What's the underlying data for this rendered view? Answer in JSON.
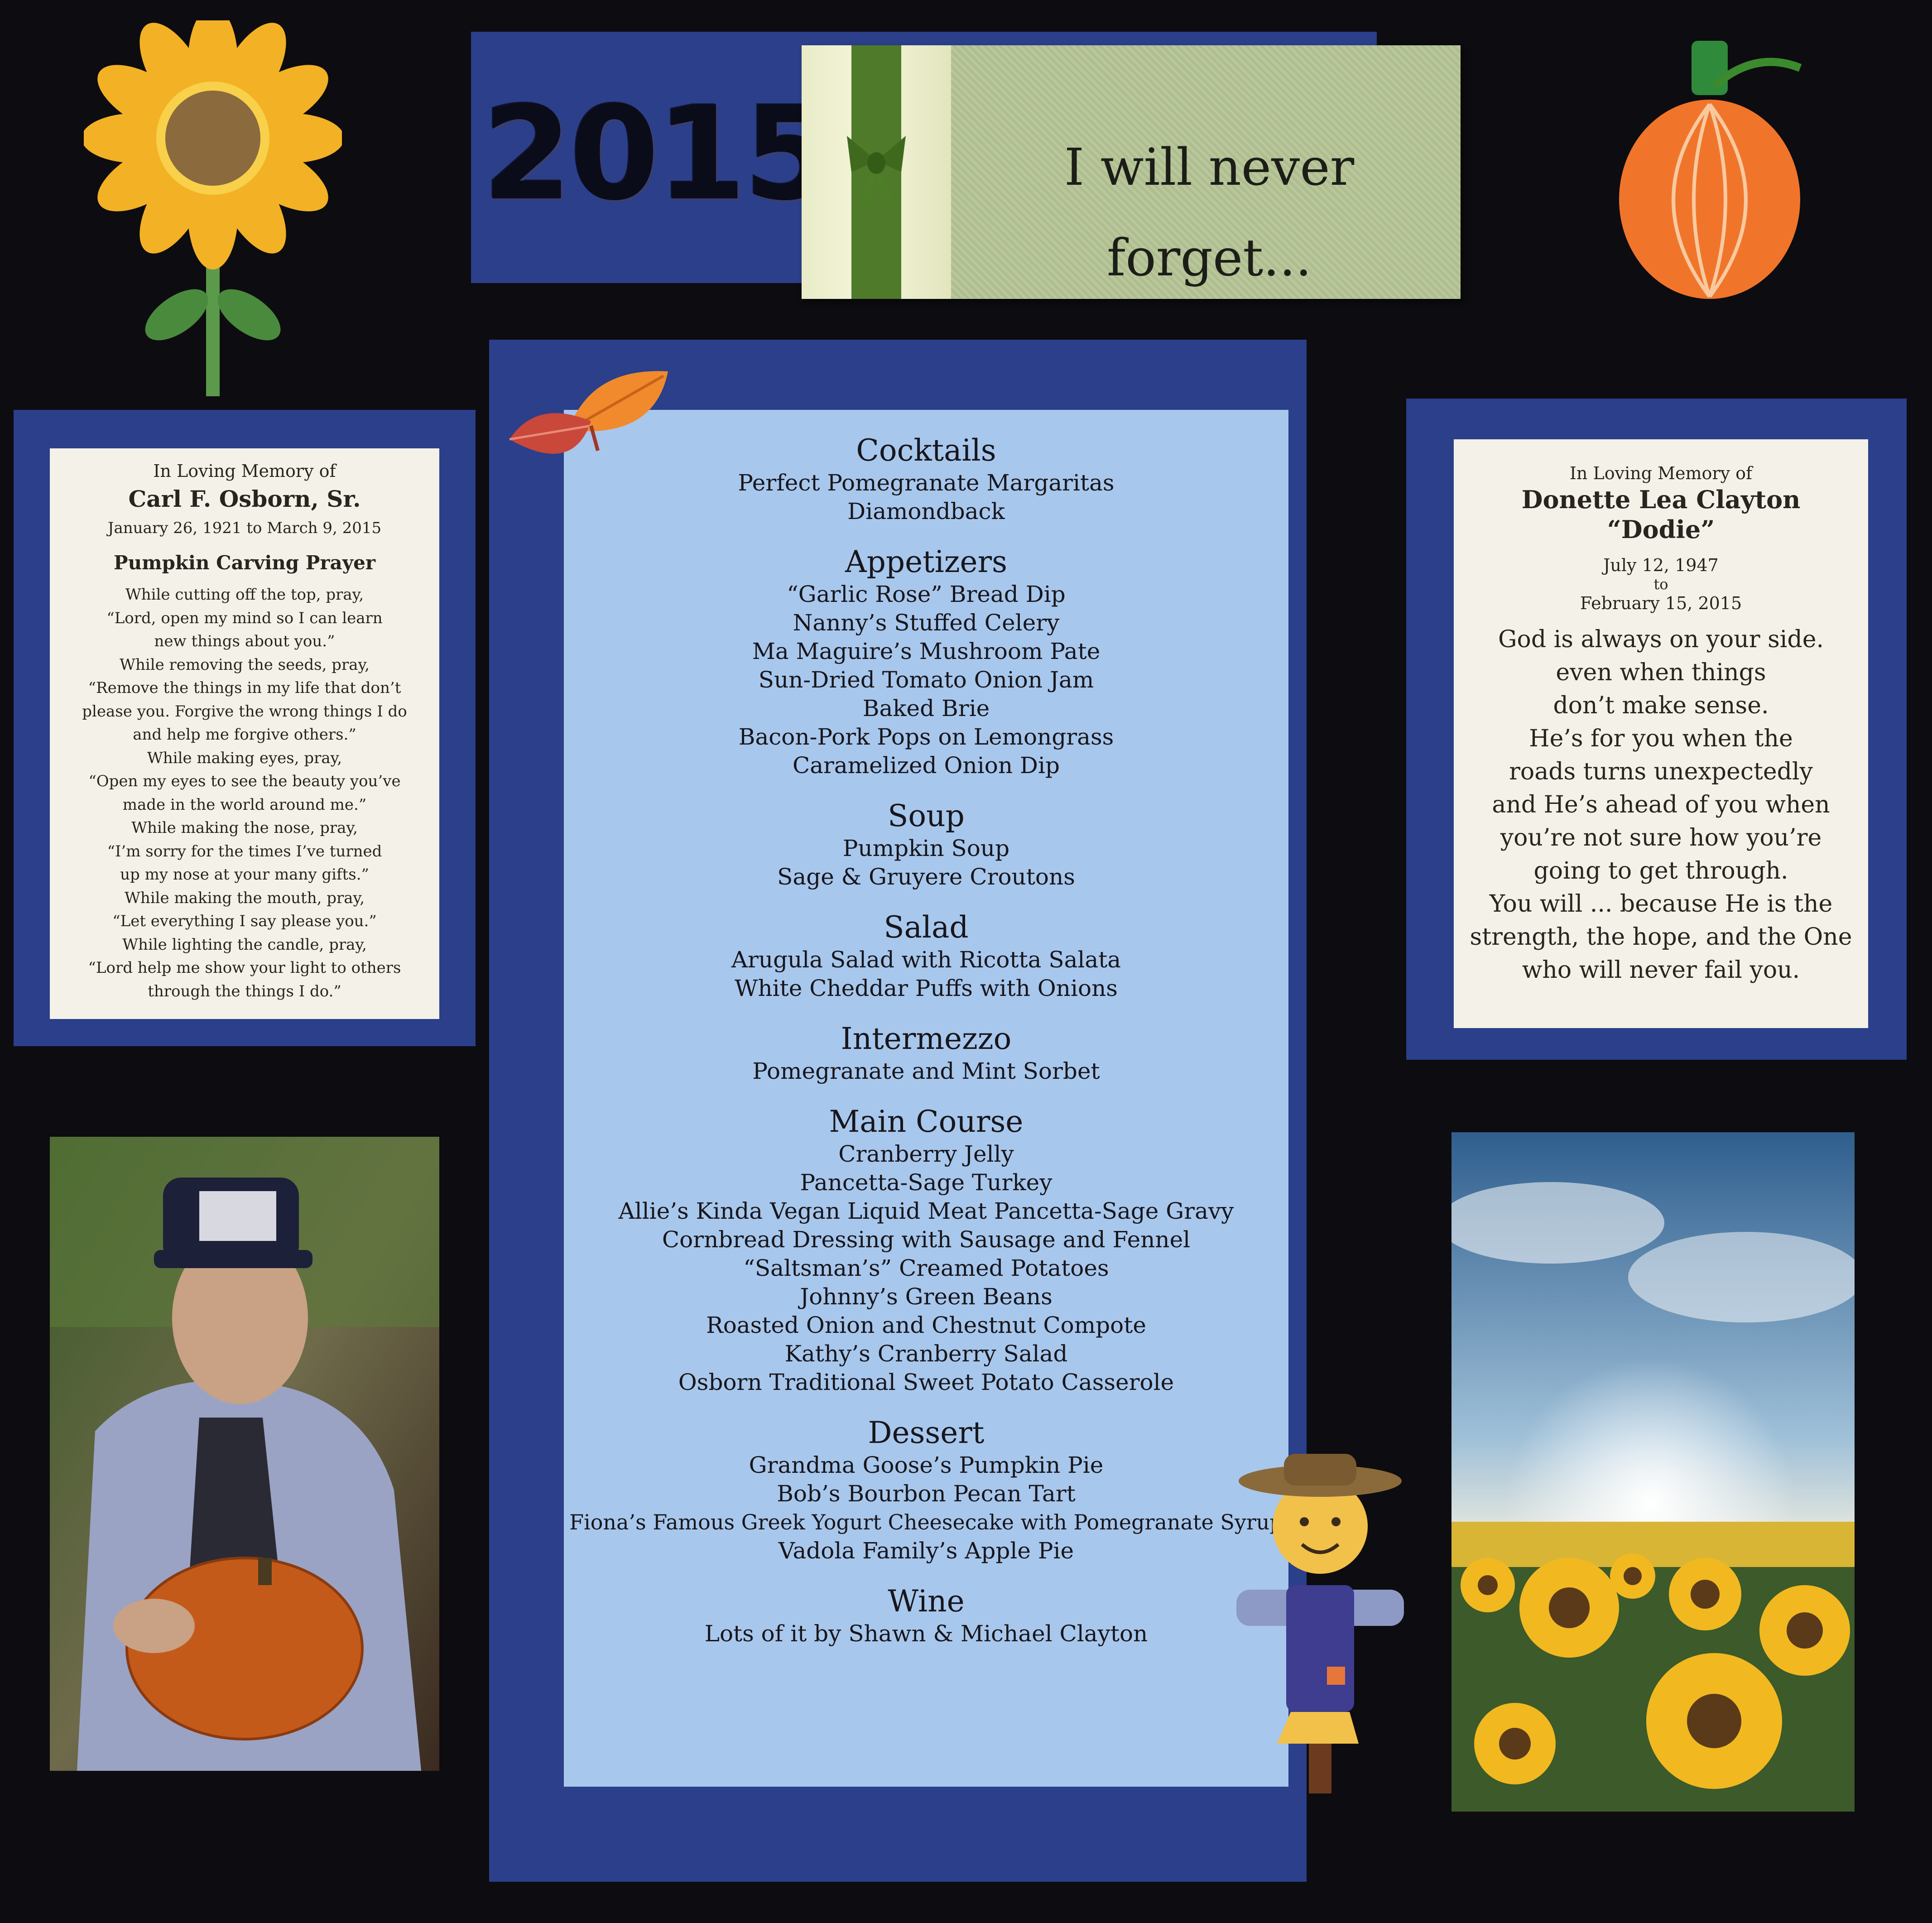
{
  "banner": {
    "year": "2015",
    "tag_text": "I will never forget..."
  },
  "left_card": {
    "heading": "In Loving Memory of",
    "name": "Carl F. Osborn, Sr.",
    "dates": "January 26, 1921 to March 9, 2015",
    "prayer_title": "Pumpkin Carving Prayer",
    "prayer_lines": [
      "While cutting off the top, pray,",
      "“Lord, open my mind so I can learn",
      "new things about you.”",
      "While removing the seeds, pray,",
      "“Remove the things in my life that don’t",
      "please you. Forgive the wrong things I do",
      "and help me forgive others.”",
      "While making eyes, pray,",
      "“Open my eyes to see the beauty you’ve",
      "made in the world around me.”",
      "While making the nose, pray,",
      "“I’m sorry for the times I’ve turned",
      "up my nose at your many gifts.”",
      "While making the mouth, pray,",
      "“Let everything I say please you.”",
      "While lighting the candle, pray,",
      "“Lord help me show your light to others",
      "through the things I do.”"
    ]
  },
  "right_card": {
    "heading": "In Loving Memory of",
    "name": "Donette Lea Clayton",
    "nickname": "“Dodie”",
    "date_start": "July 12, 1947",
    "date_to": "to",
    "date_end": "February 15, 2015",
    "verse_lines": [
      "God is always on your side.",
      "even when things",
      "don’t make sense.",
      "He’s for you when the",
      "roads turns unexpectedly",
      "and He’s ahead of you when",
      "you’re not sure how you’re",
      "going to get through.",
      "You will ... because He is the",
      "strength, the hope, and the One",
      "who will never fail you."
    ]
  },
  "menu": {
    "sections": [
      {
        "title": "Cocktails",
        "items": [
          "Perfect Pomegranate Margaritas",
          "Diamondback"
        ]
      },
      {
        "title": "Appetizers",
        "items": [
          "“Garlic Rose” Bread Dip",
          "Nanny’s Stuffed Celery",
          "Ma Maguire’s Mushroom Pate",
          "Sun-Dried Tomato Onion Jam",
          "Baked Brie",
          "Bacon-Pork Pops on Lemongrass",
          "Caramelized Onion Dip"
        ]
      },
      {
        "title": "Soup",
        "items": [
          "Pumpkin Soup",
          "Sage & Gruyere Croutons"
        ]
      },
      {
        "title": "Salad",
        "items": [
          "Arugula Salad with Ricotta Salata",
          "White Cheddar Puffs with Onions"
        ]
      },
      {
        "title": "Intermezzo",
        "items": [
          "Pomegranate and Mint Sorbet"
        ]
      },
      {
        "title": "Main Course",
        "items": [
          "Cranberry Jelly",
          "Pancetta-Sage Turkey",
          "Allie’s Kinda Vegan Liquid Meat Pancetta-Sage Gravy",
          "Cornbread Dressing with Sausage and Fennel",
          "“Saltsman’s” Creamed Potatoes",
          "Johnny’s Green Beans",
          "Roasted Onion and Chestnut Compote",
          "Kathy’s Cranberry Salad",
          "Osborn Traditional Sweet Potato Casserole"
        ]
      },
      {
        "title": "Dessert",
        "items": [
          "Grandma Goose’s Pumpkin Pie",
          "Bob’s Bourbon Pecan Tart",
          "Fiona’s Famous Greek Yogurt Cheesecake with Pomegranate Syrup",
          "Vadola Family’s Apple Pie"
        ]
      },
      {
        "title": "Wine",
        "items": [
          "Lots of it by Shawn & Michael Clayton"
        ]
      }
    ]
  },
  "colors": {
    "background": "#0d0c10",
    "mat_blue": "#2b3f8a",
    "menu_card": "#a8c7ec",
    "memory_card": "#f4f2e8",
    "tag_green": "#b9c79b"
  },
  "decorations": {
    "sunflower": "sunflower-sticker",
    "pumpkin": "pumpkin-sticker",
    "leaves": "autumn-leaves-sticker",
    "scarecrow": "scarecrow-sticker",
    "photo_left": "man-holding-pumpkin-photo",
    "photo_right": "sunflower-field-photo"
  }
}
